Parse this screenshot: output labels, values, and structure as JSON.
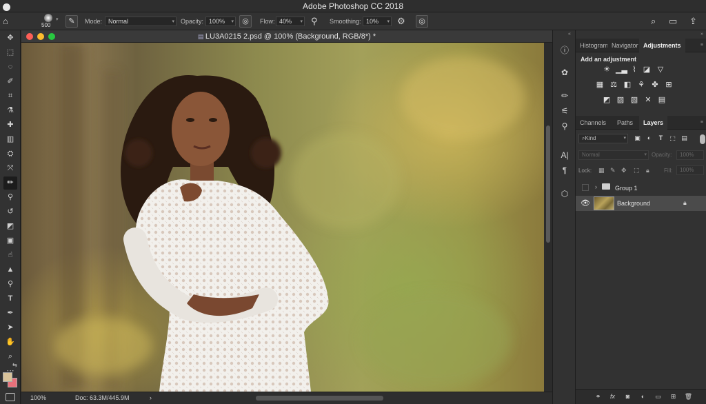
{
  "app": {
    "title": "Adobe Photoshop CC 2018"
  },
  "options_bar": {
    "brush_size": "500",
    "mode_label": "Mode:",
    "mode_value": "Normal",
    "opacity_label": "Opacity:",
    "opacity_value": "100%",
    "flow_label": "Flow:",
    "flow_value": "40%",
    "smoothing_label": "Smoothing:",
    "smoothing_value": "10%"
  },
  "document": {
    "title": "LU3A0215 2.psd @ 100% (Background, RGB/8*) *",
    "zoom": "100%",
    "doc_info": "Doc: 63.3M/445.9M"
  },
  "panels": {
    "top_tabs": [
      "Histogram",
      "Navigator",
      "Adjustments"
    ],
    "adjustments_title": "Add an adjustment",
    "bottom_tabs": [
      "Channels",
      "Paths",
      "Layers"
    ],
    "kind_label": "Kind",
    "blend_mode": "Normal",
    "opacity_label": "Opacity:",
    "opacity_value": "100%",
    "lock_label": "Lock:",
    "fill_label": "Fill:",
    "fill_value": "100%"
  },
  "layers": [
    {
      "name": "Group 1",
      "type": "group",
      "visible": false
    },
    {
      "name": "Background",
      "type": "pixel",
      "visible": true,
      "locked": true,
      "selected": true
    }
  ],
  "colors": {
    "foreground": "#d9c39a",
    "background": "#e8707a",
    "close": "#ff5f57",
    "minimize": "#febc2e",
    "zoom": "#28c840"
  }
}
